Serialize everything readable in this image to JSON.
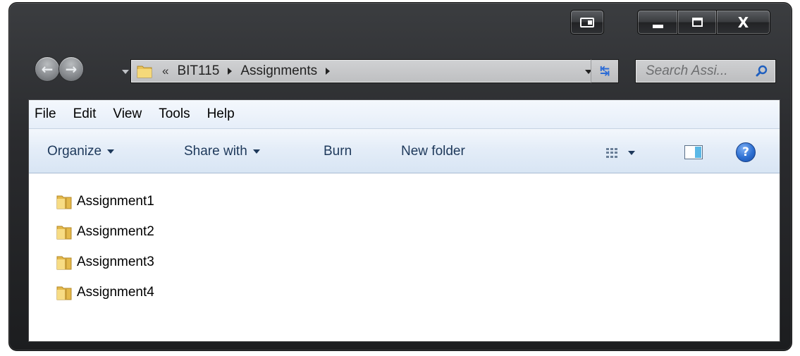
{
  "window": {
    "caption_buttons": {
      "switch": "switch-window-icon",
      "minimize": "minimize-icon",
      "maximize": "maximize-icon",
      "close": "close-icon",
      "close_glyph": "X"
    }
  },
  "navigation": {
    "back_icon": "back-arrow-icon",
    "forward_icon": "forward-arrow-icon",
    "back_glyph": "←",
    "forward_glyph": "→"
  },
  "address_bar": {
    "overflow_chevron": "«",
    "breadcrumbs": [
      "BIT115",
      "Assignments"
    ]
  },
  "refresh_glyph": "↹",
  "search": {
    "placeholder": "Search Assi..."
  },
  "menu": {
    "items": [
      "File",
      "Edit",
      "View",
      "Tools",
      "Help"
    ]
  },
  "command_bar": {
    "organize": "Organize",
    "share_with": "Share with",
    "burn": "Burn",
    "new_folder": "New folder",
    "help_glyph": "?"
  },
  "files": [
    {
      "name": "Assignment1",
      "icon": "folder-icon"
    },
    {
      "name": "Assignment2",
      "icon": "folder-icon"
    },
    {
      "name": "Assignment3",
      "icon": "folder-icon"
    },
    {
      "name": "Assignment4",
      "icon": "folder-icon"
    }
  ],
  "colors": {
    "frame": "#2a2b2e",
    "command_text": "#1e395b",
    "help_blue": "#2d6fd1",
    "folder_yellow": "#f2c94c"
  }
}
